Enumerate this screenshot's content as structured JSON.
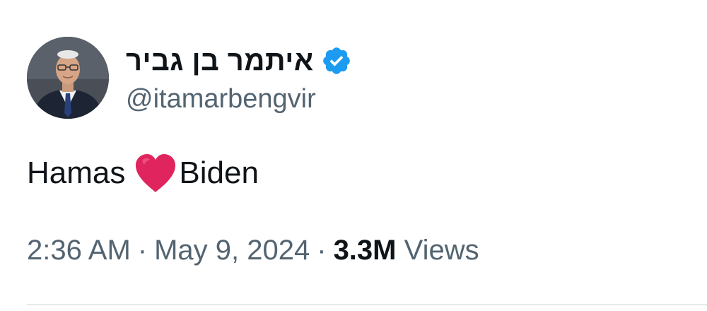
{
  "author": {
    "display_name": "איתמר בן גביר",
    "handle": "@itamarbengvir",
    "verified": true,
    "verified_color": "#1d9bf0",
    "avatar_icon": "profile-photo"
  },
  "tweet": {
    "text_before": "Hamas",
    "emoji": "heart-icon",
    "emoji_color": "#e0245e",
    "text_after": "Biden"
  },
  "meta": {
    "time": "2:36 AM",
    "separator": "·",
    "date": "May 9, 2024",
    "views_count": "3.3M",
    "views_label": "Views"
  }
}
